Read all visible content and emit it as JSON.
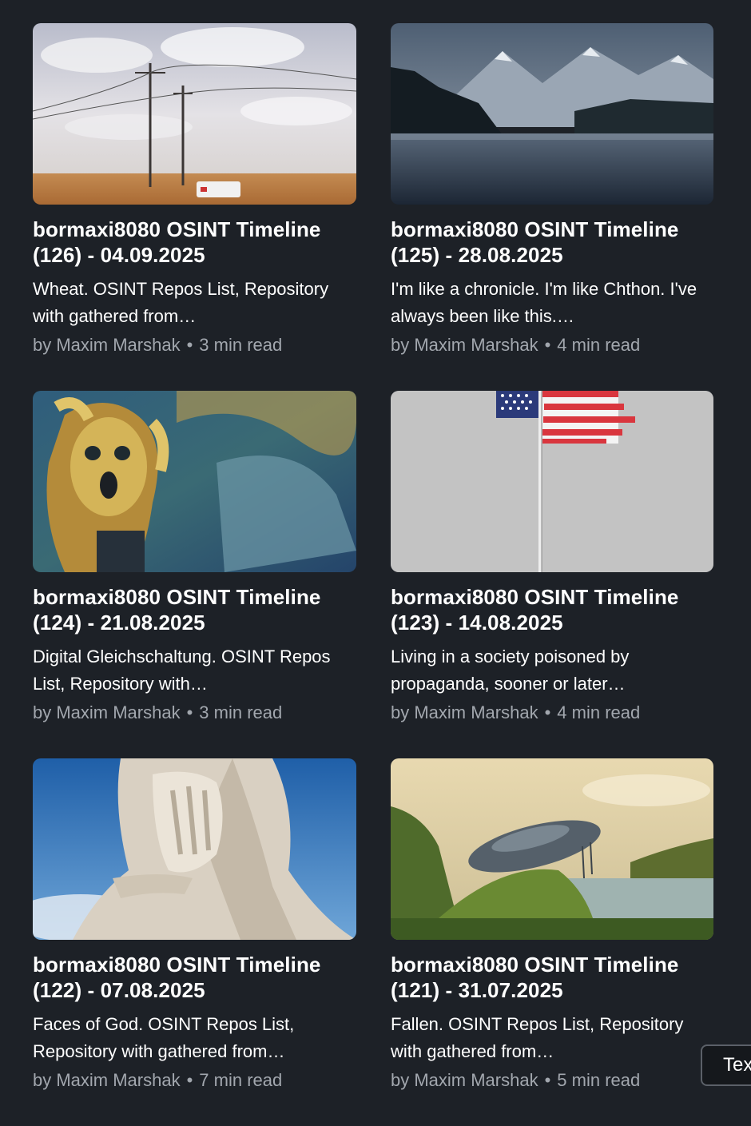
{
  "posts": [
    {
      "title": "bormaxi8080 OSINT Timeline (126) - 04.09.2025",
      "description": "Wheat. OSINT Repos List, Repository with gathered from…",
      "author": "by Maxim Marshak",
      "read_time": "3 min read",
      "image": "wheat-field-power-lines"
    },
    {
      "title": "bormaxi8080 OSINT Timeline (125) - 28.08.2025",
      "description": "I'm like a chronicle. I'm like Chthon. I've always been like this.…",
      "author": "by Maxim Marshak",
      "read_time": "4 min read",
      "image": "mountain-lake"
    },
    {
      "title": "bormaxi8080 OSINT Timeline (124) - 21.08.2025",
      "description": "Digital Gleichschaltung. OSINT Repos List, Repository with…",
      "author": "by Maxim Marshak",
      "read_time": "3 min read",
      "image": "scream-painting"
    },
    {
      "title": "bormaxi8080 OSINT Timeline (123) - 14.08.2025",
      "description": "Living in a society poisoned by propaganda, sooner or later…",
      "author": "by Maxim Marshak",
      "read_time": "4 min read",
      "image": "us-flag-pole"
    },
    {
      "title": "bormaxi8080 OSINT Timeline (122) - 07.08.2025",
      "description": "Faces of God. OSINT Repos List, Repository with gathered from…",
      "author": "by Maxim Marshak",
      "read_time": "7 min read",
      "image": "facepalm-statue"
    },
    {
      "title": "bormaxi8080 OSINT Timeline (121) - 31.07.2025",
      "description": "Fallen. OSINT Repos List, Repository with gathered from…",
      "author": "by Maxim Marshak",
      "read_time": "5 min read",
      "image": "crashed-ufo-landscape"
    }
  ],
  "floating_button": {
    "label": "Tex"
  },
  "separator": "•",
  "colors": {
    "background": "#1d2127",
    "title": "#ffffff",
    "meta": "#a2a7ae"
  }
}
